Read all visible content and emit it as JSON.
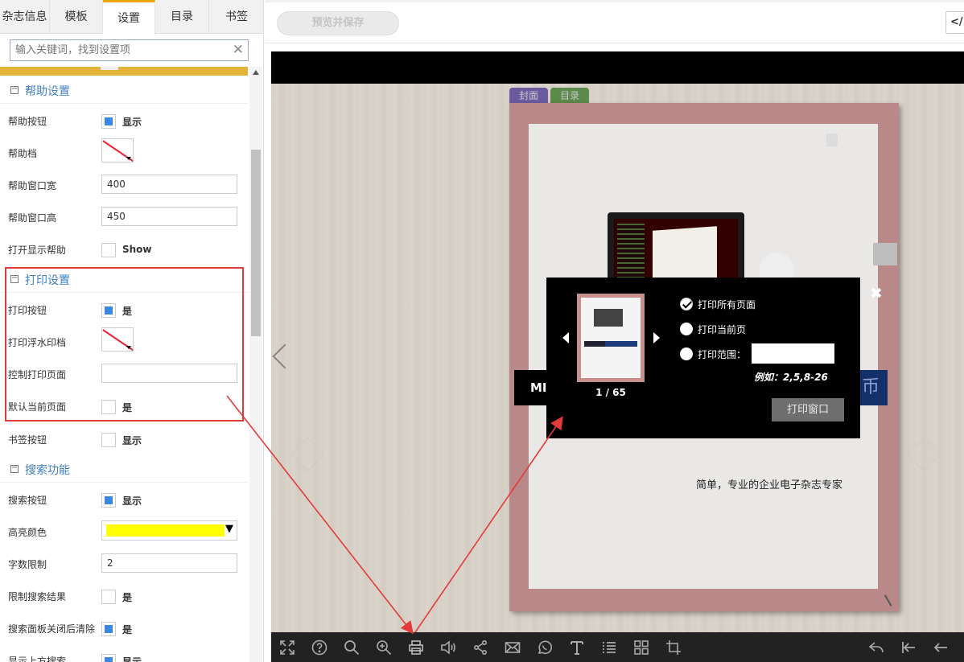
{
  "tabs": [
    "杂志信息",
    "模板",
    "设置",
    "目录",
    "书签"
  ],
  "active_tab": "设置",
  "search": {
    "placeholder": "输入关键词，找到设置项"
  },
  "help_section": {
    "title": "帮助设置",
    "rows": {
      "help_button": {
        "label": "帮助按钮",
        "value": "显示"
      },
      "help_doc": {
        "label": "帮助档"
      },
      "help_width": {
        "label": "帮助窗口宽",
        "value": "400"
      },
      "help_height": {
        "label": "帮助窗口高",
        "value": "450"
      },
      "open_show_help": {
        "label": "打开显示帮助",
        "value": "Show"
      }
    }
  },
  "print_section": {
    "title": "打印设置",
    "rows": {
      "print_button": {
        "label": "打印按钮",
        "value": "是"
      },
      "print_watermark": {
        "label": "打印浮水印档"
      },
      "control_print_pages": {
        "label": "控制打印页面",
        "value": ""
      },
      "default_current_page": {
        "label": "默认当前页面",
        "value": "是"
      }
    }
  },
  "bookmark_row": {
    "label": "书签按钮",
    "value": "显示"
  },
  "search_section": {
    "title": "搜索功能",
    "rows": {
      "search_button": {
        "label": "搜索按钮",
        "value": "显示"
      },
      "highlight_color": {
        "label": "高亮颜色",
        "color": "#ffff00"
      },
      "word_limit": {
        "label": "字数限制",
        "value": "2"
      },
      "limit_results": {
        "label": "限制搜索结果",
        "value": "是"
      },
      "clear_on_close": {
        "label": "搜索面板关闭后清除",
        "value": "是"
      },
      "show_top_search": {
        "label": "显示上方搜索",
        "value": "显示"
      }
    }
  },
  "topbar": {
    "preview_save": "预览并保存",
    "code_button": "</>"
  },
  "book": {
    "tab_cover": "封面",
    "tab_toc": "目录",
    "band_left_text": "MI",
    "band_right_text": "币",
    "slogan": "简单，专业的企业电子杂志专家"
  },
  "print_dialog": {
    "page_counter": "1 / 65",
    "options": {
      "all": "打印所有页面",
      "current": "打印当前页",
      "range": "打印范围："
    },
    "selected_option": "all",
    "example": "例如：2,5,8-26",
    "print_window_button": "打印窗口",
    "close": "✖"
  },
  "colors": {
    "accent": "#f0a500",
    "section_title": "#3f7fc5",
    "checkbox": "#3d86e3",
    "annotation": "#e53a3a",
    "yellow_bar": "#e2b53a"
  },
  "toolbar_icons": [
    "fullscreen-icon",
    "help-icon",
    "search-icon",
    "zoom-in-icon",
    "print-icon",
    "sound-icon",
    "share-icon",
    "email-icon",
    "whatsapp-icon",
    "text-icon",
    "list-icon",
    "thumbnails-icon",
    "crop-icon",
    "back-icon",
    "first-page-icon",
    "prev-page-icon"
  ]
}
